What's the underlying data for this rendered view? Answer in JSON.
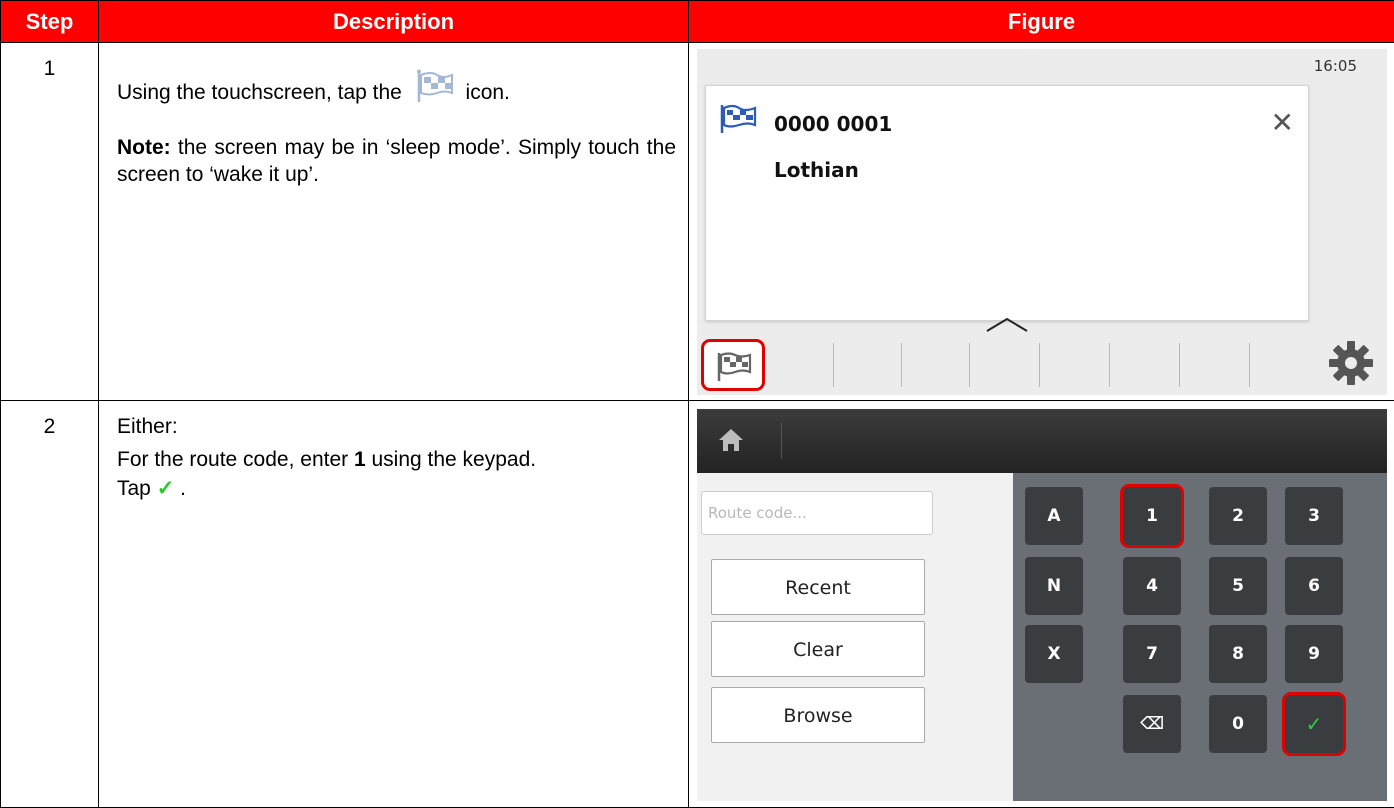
{
  "table": {
    "headers": {
      "step": "Step",
      "description": "Description",
      "figure": "Figure"
    },
    "rows": [
      {
        "step": "1",
        "text_before_icon": "Using the touchscreen, tap the",
        "text_after_icon": "icon.",
        "icon": "checkered-flag-icon",
        "note_label": "Note:",
        "note_text": " the screen may be in ‘sleep mode’. Simply touch the screen to ‘wake it up’."
      },
      {
        "step": "2",
        "line1": "Either:",
        "line2_before": "For the route code, enter ",
        "line2_bold": "1",
        "line2_after": " using the keypad.",
        "line3_before": "Tap ",
        "line3_tick": "✓",
        "line3_after": " ."
      }
    ]
  },
  "figure1": {
    "time": "16:05",
    "route_number": "0000 0001",
    "route_name": "Lothian",
    "close_icon": "close-icon",
    "settings_icon": "gear-icon",
    "highlight_color": "#e00000"
  },
  "figure2": {
    "home_icon": "home-icon",
    "route_input_placeholder": "Route code...",
    "buttons": {
      "recent": "Recent",
      "clear": "Clear",
      "browse": "Browse"
    },
    "keys": {
      "A": "A",
      "N": "N",
      "X": "X",
      "k1": "1",
      "k2": "2",
      "k3": "3",
      "k4": "4",
      "k5": "5",
      "k6": "6",
      "k7": "7",
      "k8": "8",
      "k9": "9",
      "k0": "0",
      "backspace": "⌫",
      "ok": "✓"
    }
  },
  "colors": {
    "header_bg": "#ff0000",
    "header_text": "#ffffff",
    "tick": "#22cc22"
  }
}
